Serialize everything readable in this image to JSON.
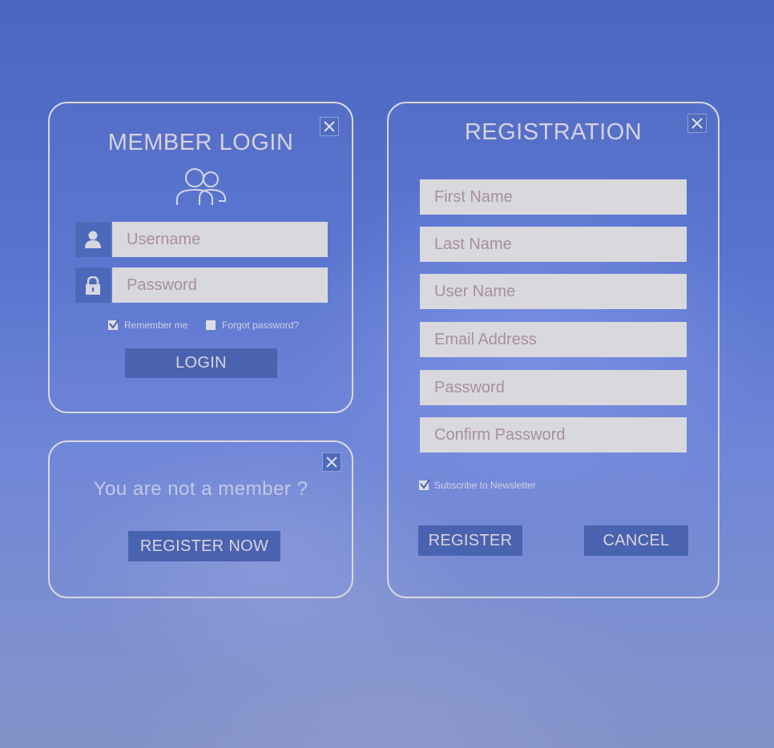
{
  "login": {
    "title": "MEMBER LOGIN",
    "username_placeholder": "Username",
    "password_placeholder": "Password",
    "remember_label": "Remember me",
    "remember_checked": true,
    "forgot_label": "Forgot password?",
    "forgot_checked": false,
    "login_label": "LOGIN"
  },
  "promo": {
    "text": "You are not a member ?",
    "register_now_label": "REGISTER NOW"
  },
  "registration": {
    "title": "REGISTRATION",
    "fields": {
      "first_name": "First Name",
      "last_name": "Last Name",
      "user_name": "User Name",
      "email": "Email Address",
      "password": "Password",
      "confirm_password": "Confirm Password"
    },
    "newsletter_label": "Subscribe to Newsletter",
    "newsletter_checked": true,
    "register_label": "REGISTER",
    "cancel_label": "CANCEL"
  },
  "icons": {
    "close": "close-icon",
    "users": "users-icon",
    "user": "user-icon",
    "lock": "lock-icon",
    "check": "checkmark-icon"
  },
  "colors": {
    "panel_border": "#d8d8de",
    "field_bg": "#d9d8dd",
    "placeholder": "#a6919d",
    "button_bg": "#4a63b0",
    "text_light": "#d6d2dc"
  }
}
